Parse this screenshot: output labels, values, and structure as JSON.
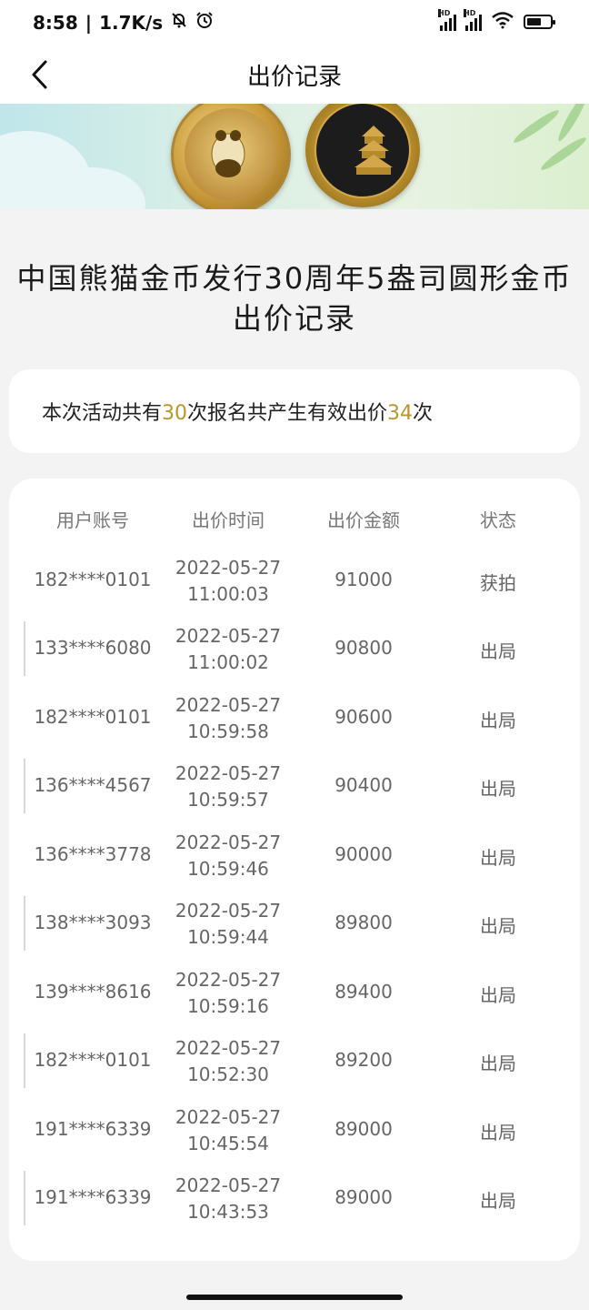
{
  "status_bar": {
    "time": "8:58",
    "speed": "1.7K/s",
    "sig1_label": "HD",
    "sig2_label": "HD"
  },
  "nav": {
    "title": "出价记录",
    "back_icon": "chevron-left-icon"
  },
  "page_title_line1": "中国熊猫金币发行30周年5盎司圆形金币",
  "page_title_line2": "出价记录",
  "summary": {
    "prefix": "本次活动共有",
    "signups": "30",
    "middle": "次报名共产生有效出价",
    "bids": "34",
    "suffix": "次",
    "highlight_color": "#b9952e"
  },
  "table": {
    "columns": [
      "用户账号",
      "出价时间",
      "出价金额",
      "状态"
    ],
    "rows": [
      {
        "account": "182****0101",
        "date": "2022-05-27",
        "time": "11:00:03",
        "amount": "91000",
        "status": "获拍"
      },
      {
        "account": "133****6080",
        "date": "2022-05-27",
        "time": "11:00:02",
        "amount": "90800",
        "status": "出局"
      },
      {
        "account": "182****0101",
        "date": "2022-05-27",
        "time": "10:59:58",
        "amount": "90600",
        "status": "出局"
      },
      {
        "account": "136****4567",
        "date": "2022-05-27",
        "time": "10:59:57",
        "amount": "90400",
        "status": "出局"
      },
      {
        "account": "136****3778",
        "date": "2022-05-27",
        "time": "10:59:46",
        "amount": "90000",
        "status": "出局"
      },
      {
        "account": "138****3093",
        "date": "2022-05-27",
        "time": "10:59:44",
        "amount": "89800",
        "status": "出局"
      },
      {
        "account": "139****8616",
        "date": "2022-05-27",
        "time": "10:59:16",
        "amount": "89400",
        "status": "出局"
      },
      {
        "account": "182****0101",
        "date": "2022-05-27",
        "time": "10:52:30",
        "amount": "89200",
        "status": "出局"
      },
      {
        "account": "191****6339",
        "date": "2022-05-27",
        "time": "10:45:54",
        "amount": "89000",
        "status": "出局"
      },
      {
        "account": "191****6339",
        "date": "2022-05-27",
        "time": "10:43:53",
        "amount": "89000",
        "status": "出局"
      }
    ]
  }
}
